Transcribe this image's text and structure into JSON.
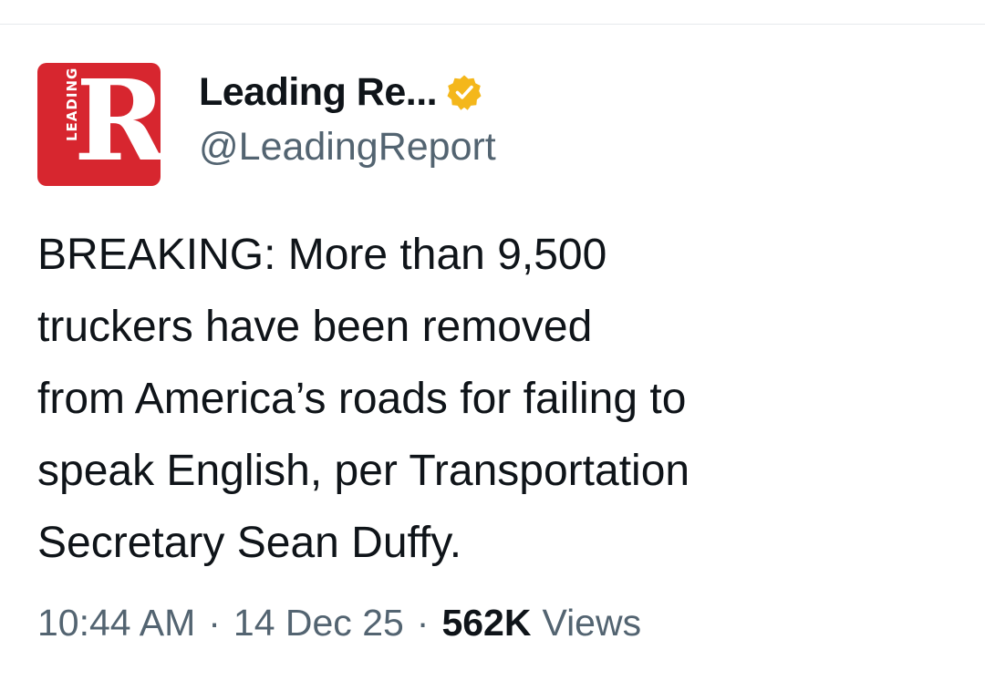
{
  "account": {
    "display_name": "Leading Re...",
    "handle": "@LeadingReport",
    "verified": true,
    "verified_badge_color": "#f4b71b",
    "avatar": {
      "letter": "R",
      "vertical_text": "LEADING",
      "background_color": "#d7262f"
    }
  },
  "tweet": {
    "text": "BREAKING: More than 9,500\ntruckers have been removed\nfrom America’s roads for failing to\nspeak English, per Transportation\nSecretary Sean Duffy."
  },
  "meta": {
    "time": "10:44 AM",
    "separator": "·",
    "date": "14 Dec 25",
    "views_count": "562K",
    "views_label": "Views"
  },
  "colors": {
    "primary_text": "#0f1419",
    "secondary_text": "#536471",
    "background": "#ffffff"
  }
}
